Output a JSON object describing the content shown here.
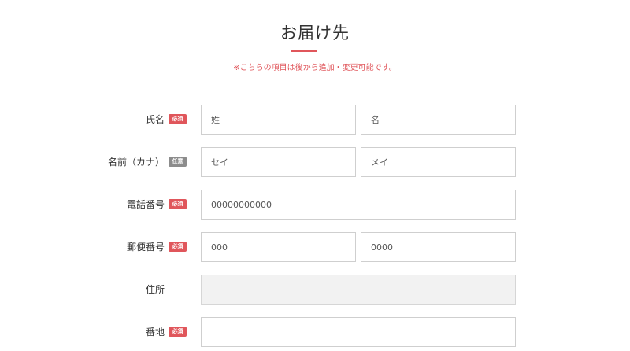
{
  "header": {
    "title": "お届け先",
    "notice": "※こちらの項目は後から追加・変更可能です。",
    "accent_color": "#e0565b"
  },
  "form": {
    "name": {
      "label": "氏名",
      "badge": "必須",
      "last_placeholder": "姓",
      "first_placeholder": "名"
    },
    "kana": {
      "label": "名前（カナ）",
      "badge": "任意",
      "last_placeholder": "セイ",
      "first_placeholder": "メイ"
    },
    "phone": {
      "label": "電話番号",
      "badge": "必須",
      "placeholder": "00000000000"
    },
    "postal": {
      "label": "郵便番号",
      "badge": "必須",
      "first_placeholder": "000",
      "second_placeholder": "0000"
    },
    "address": {
      "label": "住所",
      "value": ""
    },
    "street": {
      "label": "番地",
      "badge": "必須",
      "placeholder": ""
    }
  }
}
